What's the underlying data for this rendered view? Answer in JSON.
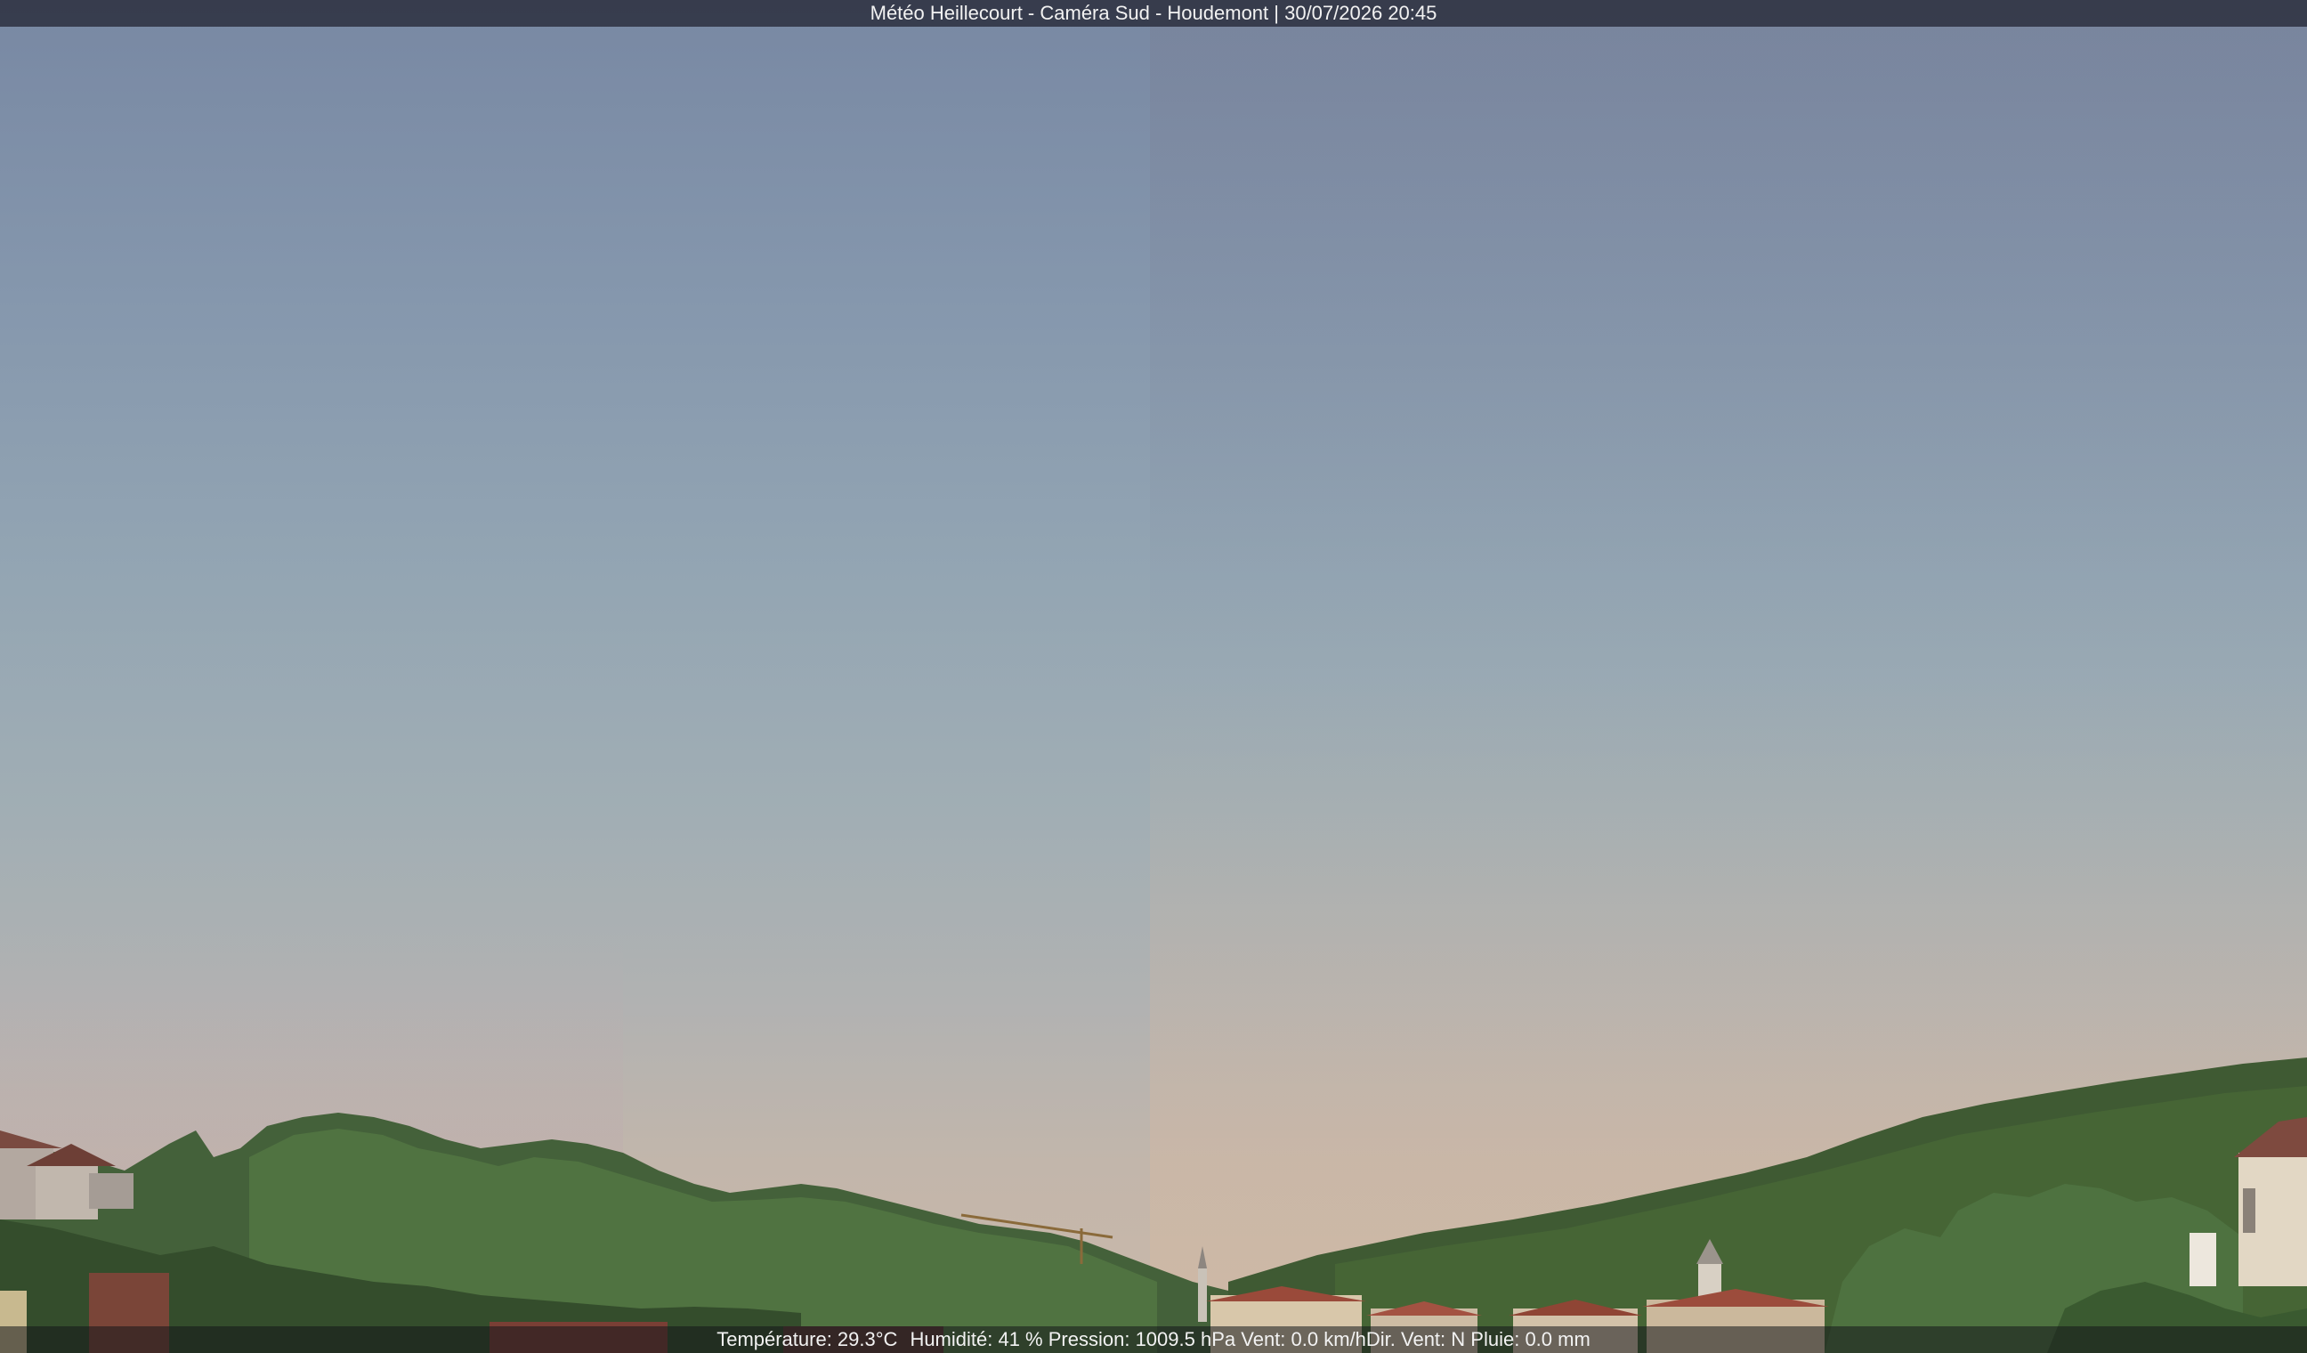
{
  "header": {
    "title": "Météo Heillecourt - Caméra Sud - Houdemont | 30/07/2026 20:45"
  },
  "weather": {
    "temperature": "Température: 29.3°C",
    "humidity": "Humidité: 41 %",
    "pressure": "Pression: 1009.5 hPa",
    "wind": "Vent: 0.0 km/h",
    "wind_dir": "Dir. Vent: N",
    "rain": "Pluie: 0.0 mm"
  },
  "scene": {
    "sky_top_color": "#7888a3",
    "sky_horizon_color": "#cbb8a8",
    "foliage_color": "#3d5a2c",
    "roof_color": "#9a4a3a"
  }
}
